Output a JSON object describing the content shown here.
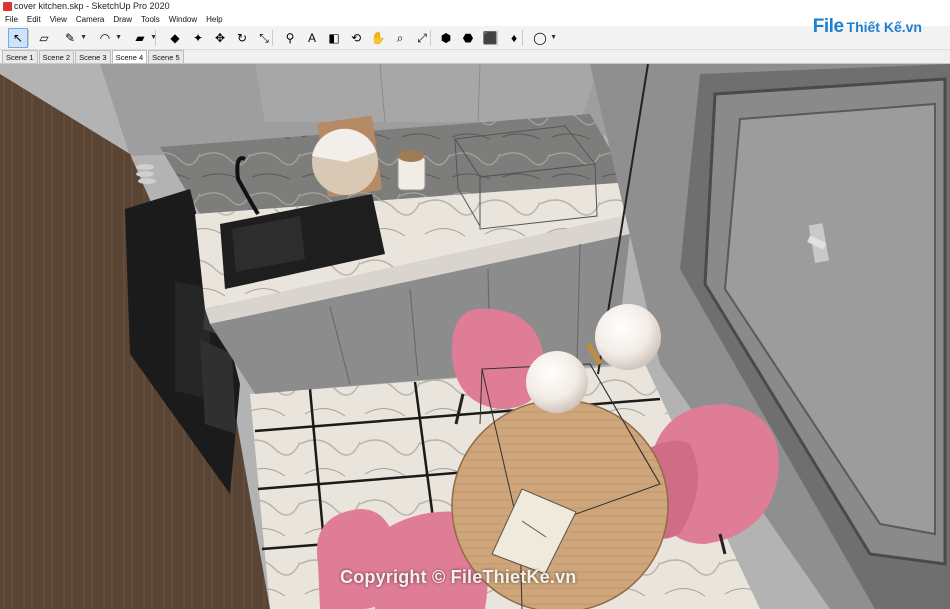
{
  "window": {
    "title": "cover kitchen.skp - SketchUp Pro 2020"
  },
  "menu": [
    "File",
    "Edit",
    "View",
    "Camera",
    "Draw",
    "Tools",
    "Window",
    "Help"
  ],
  "toolbar": {
    "tools": [
      {
        "name": "select-tool",
        "glyph": "↖",
        "active": true
      },
      {
        "name": "eraser-tool",
        "glyph": "▱"
      },
      {
        "name": "line-tool",
        "glyph": "✎",
        "dropdown": true
      },
      {
        "name": "arc-tool",
        "glyph": "◠",
        "dropdown": true
      },
      {
        "name": "shapes-tool",
        "glyph": "▰",
        "dropdown": true
      },
      {
        "name": "push-pull-tool",
        "glyph": "◆"
      },
      {
        "name": "follow-me-tool",
        "glyph": "✦"
      },
      {
        "name": "move-tool",
        "glyph": "✥"
      },
      {
        "name": "rotate-tool",
        "glyph": "↻"
      },
      {
        "name": "scale-tool",
        "glyph": "⤡"
      },
      {
        "name": "tape-measure-tool",
        "glyph": "⚲"
      },
      {
        "name": "text-tool",
        "glyph": "A"
      },
      {
        "name": "paint-bucket-tool",
        "glyph": "◧"
      },
      {
        "name": "orbit-tool",
        "glyph": "⟲"
      },
      {
        "name": "pan-tool",
        "glyph": "✋"
      },
      {
        "name": "zoom-tool",
        "glyph": "⌕"
      },
      {
        "name": "zoom-extents-tool",
        "glyph": "⤢"
      },
      {
        "name": "warehouse-tool",
        "glyph": "⬢"
      },
      {
        "name": "extension-warehouse-tool",
        "glyph": "⬣"
      },
      {
        "name": "layout-send-tool",
        "glyph": "⬛"
      },
      {
        "name": "extension-manager-tool",
        "glyph": "♦"
      },
      {
        "name": "account-tool",
        "glyph": "◯",
        "dropdown": true
      }
    ]
  },
  "scenes": [
    {
      "label": "Scene 1"
    },
    {
      "label": "Scene 2"
    },
    {
      "label": "Scene 3"
    },
    {
      "label": "Scene 4",
      "selected": true
    },
    {
      "label": "Scene 5"
    }
  ],
  "logo": {
    "left": "File",
    "right": "Thiết Kế.vn"
  },
  "watermark": "Copyright © FileThietKe.vn",
  "colors": {
    "chair": "#e07d96",
    "table_wood": "#c9a279",
    "cabinet_gray": "#8c8c8c",
    "wall_wood": "#5b4636",
    "window_frame": "#6e6e6e"
  }
}
